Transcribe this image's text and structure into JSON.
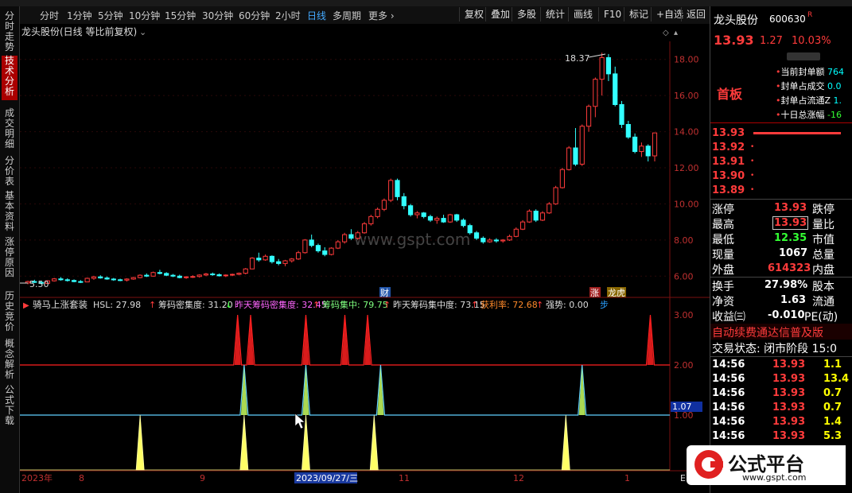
{
  "toolbar": {
    "periods": [
      "分时",
      "1分钟",
      "5分钟",
      "10分钟",
      "15分钟",
      "30分钟",
      "60分钟",
      "2小时",
      "日线",
      "多周期",
      "更多 ›"
    ],
    "active_period": "日线",
    "buttons": [
      "复权",
      "叠加",
      "多股",
      "统计",
      "画线",
      "F10",
      "标记",
      "+自选",
      "返回"
    ]
  },
  "left_tabs": [
    "分时走势",
    "技术分析",
    "成交明细",
    "分价表",
    "基本资料",
    "涨停原因",
    "历史竞价",
    "概念解析",
    "公式下载"
  ],
  "left_tab_selected": "技术分析",
  "chart": {
    "title": "龙头股份(日线 等比前复权)",
    "watermark": "www.gspt.com",
    "price_axis": [
      "18.00",
      "16.00",
      "14.00",
      "12.00",
      "10.00",
      "8.00",
      "6.00"
    ],
    "max_label": "18.37",
    "min_label": "5.50",
    "marker_cai": "财",
    "marker_zhang": "涨",
    "marker_longhu": "龙虎",
    "indicator_name": "骑马上涨套装",
    "indicator_items": [
      {
        "label": "HSL: 27.98",
        "arrow": "↑",
        "color": "#dddddd",
        "arrow_color": "#ff3b3b"
      },
      {
        "label": "筹码密集度: 31.20",
        "arrow": "↓",
        "color": "#dddddd",
        "arrow_color": "#3f3"
      },
      {
        "label": "昨天筹码密集度: 32.45",
        "arrow": "↑",
        "color": "#ff66ff",
        "arrow_color": "#ff3b3b"
      },
      {
        "label": "筹码集中: 79.75",
        "arrow": "↑",
        "color": "#7fff7f",
        "arrow_color": "#ff3b3b"
      },
      {
        "label": "昨天筹码集中度: 73.15",
        "arrow": "↑",
        "color": "#dddddd",
        "arrow_color": "#ff3b3b"
      },
      {
        "label": "获利率: 72.68",
        "arrow": "↑",
        "color": "#ff8a2a",
        "arrow_color": "#ff3b3b"
      },
      {
        "label": "强势: 0.00",
        "arrow": "",
        "color": "#dddddd",
        "arrow_color": "#ff3b3b"
      },
      {
        "label": "步",
        "arrow": "",
        "color": "#2aa0ff",
        "arrow_color": "#ff3b3b"
      }
    ],
    "indicator_axis": [
      "3.00",
      "2.00",
      "1.00"
    ],
    "indicator_value_badge": "1.07",
    "dates": [
      "2023年",
      "8",
      "9",
      "2023/09/27/三",
      "11",
      "12",
      "1"
    ],
    "corner_label": "E"
  },
  "quote": {
    "name": "龙头股份",
    "code": "600630",
    "flag": "R",
    "price": "13.93",
    "change": "1.27",
    "pct": "10.03%",
    "board": "首板",
    "info_rows": [
      {
        "label": "当前封单额",
        "value": "764"
      },
      {
        "label": "封单占成交",
        "value": "0.0"
      },
      {
        "label": "封单占流通Z",
        "value": "1."
      },
      {
        "label": "十日总涨幅",
        "value": "-16"
      }
    ],
    "order_book": [
      "13.93",
      "13.92",
      "13.91",
      "13.90",
      "13.89"
    ],
    "stats": [
      {
        "l1": "涨停",
        "v1": "13.93",
        "l2": "跌停",
        "v1c": "#ff3b3b"
      },
      {
        "l1": "最高",
        "v1": "13.93",
        "l2": "量比",
        "v1c": "#ff3b3b"
      },
      {
        "l1": "最低",
        "v1": "12.35",
        "l2": "市值",
        "v1c": "#3f3"
      },
      {
        "l1": "现量",
        "v1": "1067",
        "l2": "总量",
        "v1c": "#ffffff"
      },
      {
        "l1": "外盘",
        "v1": "614323",
        "l2": "内盘",
        "v1c": "#ff3b3b"
      }
    ],
    "stats2": [
      {
        "l1": "换手",
        "v1": "27.98%",
        "l2": "股本"
      },
      {
        "l1": "净资",
        "v1": "1.63",
        "l2": "流通"
      },
      {
        "l1": "收益㈢",
        "v1": "-0.010",
        "l2": "PE(动)"
      }
    ],
    "promo": "自动续费通达信普及版",
    "trade_state": "交易状态: 闭市阶段 15:0",
    "ticks": [
      {
        "time": "14:56",
        "price": "13.93",
        "vol": "1.1"
      },
      {
        "time": "14:56",
        "price": "13.93",
        "vol": "13.4"
      },
      {
        "time": "14:56",
        "price": "13.93",
        "vol": "0.7"
      },
      {
        "time": "14:56",
        "price": "13.93",
        "vol": "0.7"
      },
      {
        "time": "14:56",
        "price": "13.93",
        "vol": "1.4"
      },
      {
        "time": "14:56",
        "price": "13.93",
        "vol": "5.3"
      }
    ]
  },
  "logo": {
    "text": "公式平台",
    "url": "www.gspt.com"
  },
  "colors": {
    "up": "#ff3b3b",
    "down": "#3ff",
    "grid": "#7a1010",
    "signal_red": "#ff2020",
    "signal_yellow": "#ffff66"
  },
  "chart_data": {
    "type": "candlestick",
    "price_range": [
      5.5,
      18.37
    ],
    "series": [
      {
        "name": "K线",
        "ohlc": [
          [
            5.62,
            5.75,
            5.55,
            5.7
          ],
          [
            5.7,
            5.8,
            5.62,
            5.66
          ],
          [
            5.66,
            5.72,
            5.55,
            5.6
          ],
          [
            5.6,
            5.78,
            5.58,
            5.74
          ],
          [
            5.74,
            5.9,
            5.7,
            5.85
          ],
          [
            5.85,
            5.95,
            5.75,
            5.8
          ],
          [
            5.8,
            5.88,
            5.7,
            5.76
          ],
          [
            5.76,
            5.82,
            5.66,
            5.7
          ],
          [
            5.7,
            5.78,
            5.62,
            5.68
          ],
          [
            5.68,
            5.92,
            5.66,
            5.88
          ],
          [
            5.88,
            6.02,
            5.8,
            5.96
          ],
          [
            5.96,
            6.05,
            5.86,
            5.9
          ],
          [
            5.9,
            5.98,
            5.8,
            5.84
          ],
          [
            5.84,
            5.9,
            5.74,
            5.8
          ],
          [
            5.8,
            5.86,
            5.72,
            5.78
          ],
          [
            5.78,
            5.88,
            5.7,
            5.84
          ],
          [
            5.84,
            5.96,
            5.8,
            5.92
          ],
          [
            5.92,
            6.1,
            5.88,
            6.05
          ],
          [
            6.05,
            6.15,
            5.95,
            6.0
          ],
          [
            6.0,
            6.25,
            5.98,
            6.2
          ],
          [
            6.2,
            6.35,
            6.1,
            6.15
          ],
          [
            6.15,
            6.22,
            6.0,
            6.05
          ],
          [
            6.05,
            6.12,
            5.95,
            6.0
          ],
          [
            6.0,
            6.08,
            5.88,
            5.92
          ],
          [
            5.92,
            6.0,
            5.85,
            5.96
          ],
          [
            5.96,
            6.05,
            5.9,
            5.98
          ],
          [
            5.98,
            6.1,
            5.92,
            6.06
          ],
          [
            6.06,
            6.18,
            6.0,
            6.12
          ],
          [
            6.12,
            6.2,
            6.02,
            6.08
          ],
          [
            6.08,
            6.15,
            5.98,
            6.02
          ],
          [
            6.02,
            6.1,
            5.95,
            6.06
          ],
          [
            6.06,
            6.14,
            6.0,
            6.1
          ],
          [
            6.1,
            6.2,
            6.05,
            6.16
          ],
          [
            6.16,
            6.45,
            6.1,
            6.4
          ],
          [
            6.4,
            7.05,
            6.38,
            7.0
          ],
          [
            7.0,
            7.3,
            6.8,
            6.9
          ],
          [
            6.9,
            7.2,
            6.85,
            7.1
          ],
          [
            7.1,
            7.15,
            6.7,
            6.8
          ],
          [
            6.8,
            6.95,
            6.6,
            6.7
          ],
          [
            6.7,
            6.9,
            6.55,
            6.85
          ],
          [
            6.85,
            7.0,
            6.75,
            6.95
          ],
          [
            6.95,
            7.4,
            6.9,
            7.3
          ],
          [
            7.3,
            8.05,
            7.25,
            8.0
          ],
          [
            8.0,
            8.3,
            7.6,
            7.7
          ],
          [
            7.7,
            7.8,
            7.3,
            7.4
          ],
          [
            7.4,
            7.6,
            7.1,
            7.2
          ],
          [
            7.2,
            7.6,
            7.15,
            7.55
          ],
          [
            7.55,
            8.0,
            7.5,
            7.9
          ],
          [
            7.9,
            8.4,
            7.8,
            8.3
          ],
          [
            8.3,
            8.6,
            8.0,
            8.1
          ],
          [
            8.1,
            8.5,
            8.0,
            8.4
          ],
          [
            8.4,
            9.0,
            8.35,
            8.9
          ],
          [
            8.9,
            9.4,
            8.8,
            9.3
          ],
          [
            9.3,
            9.8,
            9.2,
            9.7
          ],
          [
            9.7,
            10.3,
            9.6,
            10.2
          ],
          [
            10.2,
            11.4,
            10.1,
            11.3
          ],
          [
            11.3,
            11.4,
            10.2,
            10.4
          ],
          [
            10.4,
            10.6,
            9.7,
            9.9
          ],
          [
            9.9,
            10.0,
            9.3,
            9.4
          ],
          [
            9.4,
            9.6,
            9.2,
            9.5
          ],
          [
            9.5,
            9.55,
            9.2,
            9.3
          ],
          [
            9.3,
            9.4,
            9.0,
            9.1
          ],
          [
            9.1,
            9.3,
            8.9,
            9.2
          ],
          [
            9.2,
            9.4,
            8.95,
            9.0
          ],
          [
            9.0,
            9.45,
            8.95,
            9.4
          ],
          [
            9.4,
            9.45,
            9.0,
            9.1
          ],
          [
            9.1,
            9.2,
            8.7,
            8.8
          ],
          [
            8.8,
            8.9,
            8.3,
            8.4
          ],
          [
            8.4,
            8.5,
            8.0,
            8.1
          ],
          [
            8.1,
            8.2,
            7.8,
            7.9
          ],
          [
            7.9,
            8.1,
            7.85,
            8.0
          ],
          [
            8.0,
            8.1,
            7.85,
            7.95
          ],
          [
            7.95,
            8.05,
            7.85,
            8.0
          ],
          [
            8.0,
            8.3,
            7.95,
            8.2
          ],
          [
            8.2,
            8.7,
            8.15,
            8.6
          ],
          [
            8.6,
            9.1,
            8.55,
            9.0
          ],
          [
            9.0,
            9.7,
            8.95,
            9.6
          ],
          [
            9.6,
            9.7,
            9.0,
            9.1
          ],
          [
            9.1,
            9.6,
            9.05,
            9.5
          ],
          [
            9.5,
            10.1,
            9.45,
            10.0
          ],
          [
            10.0,
            11.0,
            9.95,
            10.9
          ],
          [
            10.9,
            12.0,
            10.85,
            11.9
          ],
          [
            11.9,
            13.2,
            11.85,
            13.1
          ],
          [
            13.1,
            14.2,
            12.1,
            12.2
          ],
          [
            12.2,
            14.4,
            12.1,
            14.3
          ],
          [
            14.3,
            15.5,
            14.0,
            15.4
          ],
          [
            15.4,
            17.0,
            14.8,
            16.9
          ],
          [
            16.9,
            18.37,
            16.0,
            18.1
          ],
          [
            18.1,
            18.3,
            16.8,
            17.2
          ],
          [
            17.2,
            17.6,
            15.4,
            15.5
          ],
          [
            15.5,
            15.7,
            14.2,
            14.4
          ],
          [
            14.4,
            14.6,
            13.6,
            13.7
          ],
          [
            13.7,
            13.9,
            12.8,
            12.9
          ],
          [
            12.9,
            13.4,
            12.6,
            13.2
          ],
          [
            13.2,
            13.3,
            12.35,
            12.66
          ],
          [
            12.66,
            13.93,
            12.35,
            13.93
          ]
        ]
      }
    ],
    "indicator_series": [
      {
        "name": "红",
        "level": 3,
        "peaks": [
          0.335,
          0.355,
          0.44,
          0.5,
          0.535,
          0.97
        ]
      },
      {
        "name": "黄绿",
        "level": 2,
        "peaks": [
          0.345,
          0.44,
          0.555,
          0.865
        ]
      },
      {
        "name": "黄",
        "level": 1,
        "peaks": [
          0.185,
          0.345,
          0.44,
          0.545,
          0.84
        ]
      }
    ]
  }
}
